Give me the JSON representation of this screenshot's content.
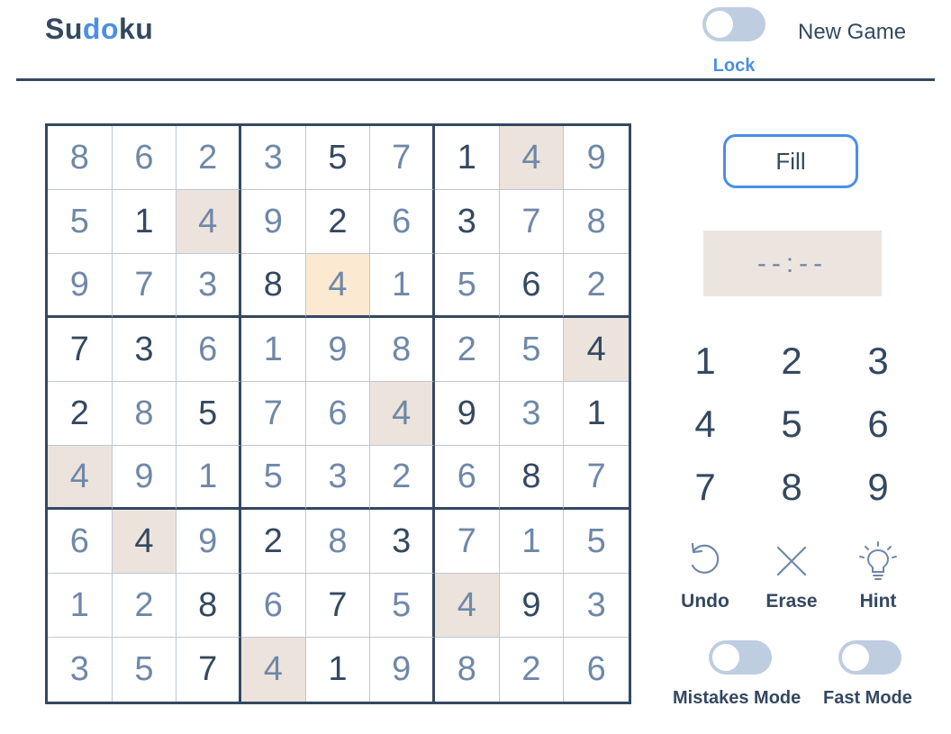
{
  "header": {
    "logo_part1": "Su",
    "logo_part2": "do",
    "logo_part3": "ku",
    "lock_label": "Lock",
    "new_game_label": "New Game"
  },
  "board": {
    "cells": [
      [
        {
          "v": "8",
          "t": "user"
        },
        {
          "v": "6",
          "t": "user"
        },
        {
          "v": "2",
          "t": "user"
        },
        {
          "v": "3",
          "t": "user"
        },
        {
          "v": "5",
          "t": "given"
        },
        {
          "v": "7",
          "t": "user"
        },
        {
          "v": "1",
          "t": "given"
        },
        {
          "v": "4",
          "t": "user",
          "hl": true
        },
        {
          "v": "9",
          "t": "user"
        }
      ],
      [
        {
          "v": "5",
          "t": "user"
        },
        {
          "v": "1",
          "t": "given"
        },
        {
          "v": "4",
          "t": "user",
          "hl": true
        },
        {
          "v": "9",
          "t": "user"
        },
        {
          "v": "2",
          "t": "given"
        },
        {
          "v": "6",
          "t": "user"
        },
        {
          "v": "3",
          "t": "given"
        },
        {
          "v": "7",
          "t": "user"
        },
        {
          "v": "8",
          "t": "user"
        }
      ],
      [
        {
          "v": "9",
          "t": "user"
        },
        {
          "v": "7",
          "t": "user"
        },
        {
          "v": "3",
          "t": "user"
        },
        {
          "v": "8",
          "t": "given"
        },
        {
          "v": "4",
          "t": "user",
          "sel": true
        },
        {
          "v": "1",
          "t": "user"
        },
        {
          "v": "5",
          "t": "user"
        },
        {
          "v": "6",
          "t": "given"
        },
        {
          "v": "2",
          "t": "user"
        }
      ],
      [
        {
          "v": "7",
          "t": "given"
        },
        {
          "v": "3",
          "t": "given"
        },
        {
          "v": "6",
          "t": "user"
        },
        {
          "v": "1",
          "t": "user"
        },
        {
          "v": "9",
          "t": "user"
        },
        {
          "v": "8",
          "t": "user"
        },
        {
          "v": "2",
          "t": "user"
        },
        {
          "v": "5",
          "t": "user"
        },
        {
          "v": "4",
          "t": "given",
          "hl": true
        }
      ],
      [
        {
          "v": "2",
          "t": "given"
        },
        {
          "v": "8",
          "t": "user"
        },
        {
          "v": "5",
          "t": "given"
        },
        {
          "v": "7",
          "t": "user"
        },
        {
          "v": "6",
          "t": "user"
        },
        {
          "v": "4",
          "t": "user",
          "hl": true
        },
        {
          "v": "9",
          "t": "given"
        },
        {
          "v": "3",
          "t": "user"
        },
        {
          "v": "1",
          "t": "given"
        }
      ],
      [
        {
          "v": "4",
          "t": "user",
          "hl": true
        },
        {
          "v": "9",
          "t": "user"
        },
        {
          "v": "1",
          "t": "user"
        },
        {
          "v": "5",
          "t": "user"
        },
        {
          "v": "3",
          "t": "user"
        },
        {
          "v": "2",
          "t": "user"
        },
        {
          "v": "6",
          "t": "user"
        },
        {
          "v": "8",
          "t": "given"
        },
        {
          "v": "7",
          "t": "user"
        }
      ],
      [
        {
          "v": "6",
          "t": "user"
        },
        {
          "v": "4",
          "t": "given",
          "hl": true
        },
        {
          "v": "9",
          "t": "user"
        },
        {
          "v": "2",
          "t": "given"
        },
        {
          "v": "8",
          "t": "user"
        },
        {
          "v": "3",
          "t": "given"
        },
        {
          "v": "7",
          "t": "user"
        },
        {
          "v": "1",
          "t": "user"
        },
        {
          "v": "5",
          "t": "user"
        }
      ],
      [
        {
          "v": "1",
          "t": "user"
        },
        {
          "v": "2",
          "t": "user"
        },
        {
          "v": "8",
          "t": "given"
        },
        {
          "v": "6",
          "t": "user"
        },
        {
          "v": "7",
          "t": "given"
        },
        {
          "v": "5",
          "t": "user"
        },
        {
          "v": "4",
          "t": "user",
          "hl": true
        },
        {
          "v": "9",
          "t": "given"
        },
        {
          "v": "3",
          "t": "user"
        }
      ],
      [
        {
          "v": "3",
          "t": "user"
        },
        {
          "v": "5",
          "t": "user"
        },
        {
          "v": "7",
          "t": "given"
        },
        {
          "v": "4",
          "t": "user",
          "hl": true
        },
        {
          "v": "1",
          "t": "given"
        },
        {
          "v": "9",
          "t": "user"
        },
        {
          "v": "8",
          "t": "user"
        },
        {
          "v": "2",
          "t": "user"
        },
        {
          "v": "6",
          "t": "user"
        }
      ]
    ]
  },
  "panel": {
    "fill_label": "Fill",
    "timer_text": "--:--",
    "numbers": [
      "1",
      "2",
      "3",
      "4",
      "5",
      "6",
      "7",
      "8",
      "9"
    ],
    "undo_label": "Undo",
    "erase_label": "Erase",
    "hint_label": "Hint",
    "mistakes_mode_label": "Mistakes Mode",
    "fast_mode_label": "Fast Mode"
  },
  "toggles": {
    "lock_on": false,
    "mistakes_mode_on": false,
    "fast_mode_on": false
  },
  "icons": {
    "undo": "undo-icon",
    "erase": "close-icon",
    "hint": "lightbulb-icon"
  },
  "colors": {
    "accent": "#4a90e2",
    "text_dark": "#344861",
    "text_user": "#6f88a8",
    "highlight": "#ebe3dc",
    "selected": "#fbe9d2",
    "toggle_off": "#bfcde0"
  }
}
